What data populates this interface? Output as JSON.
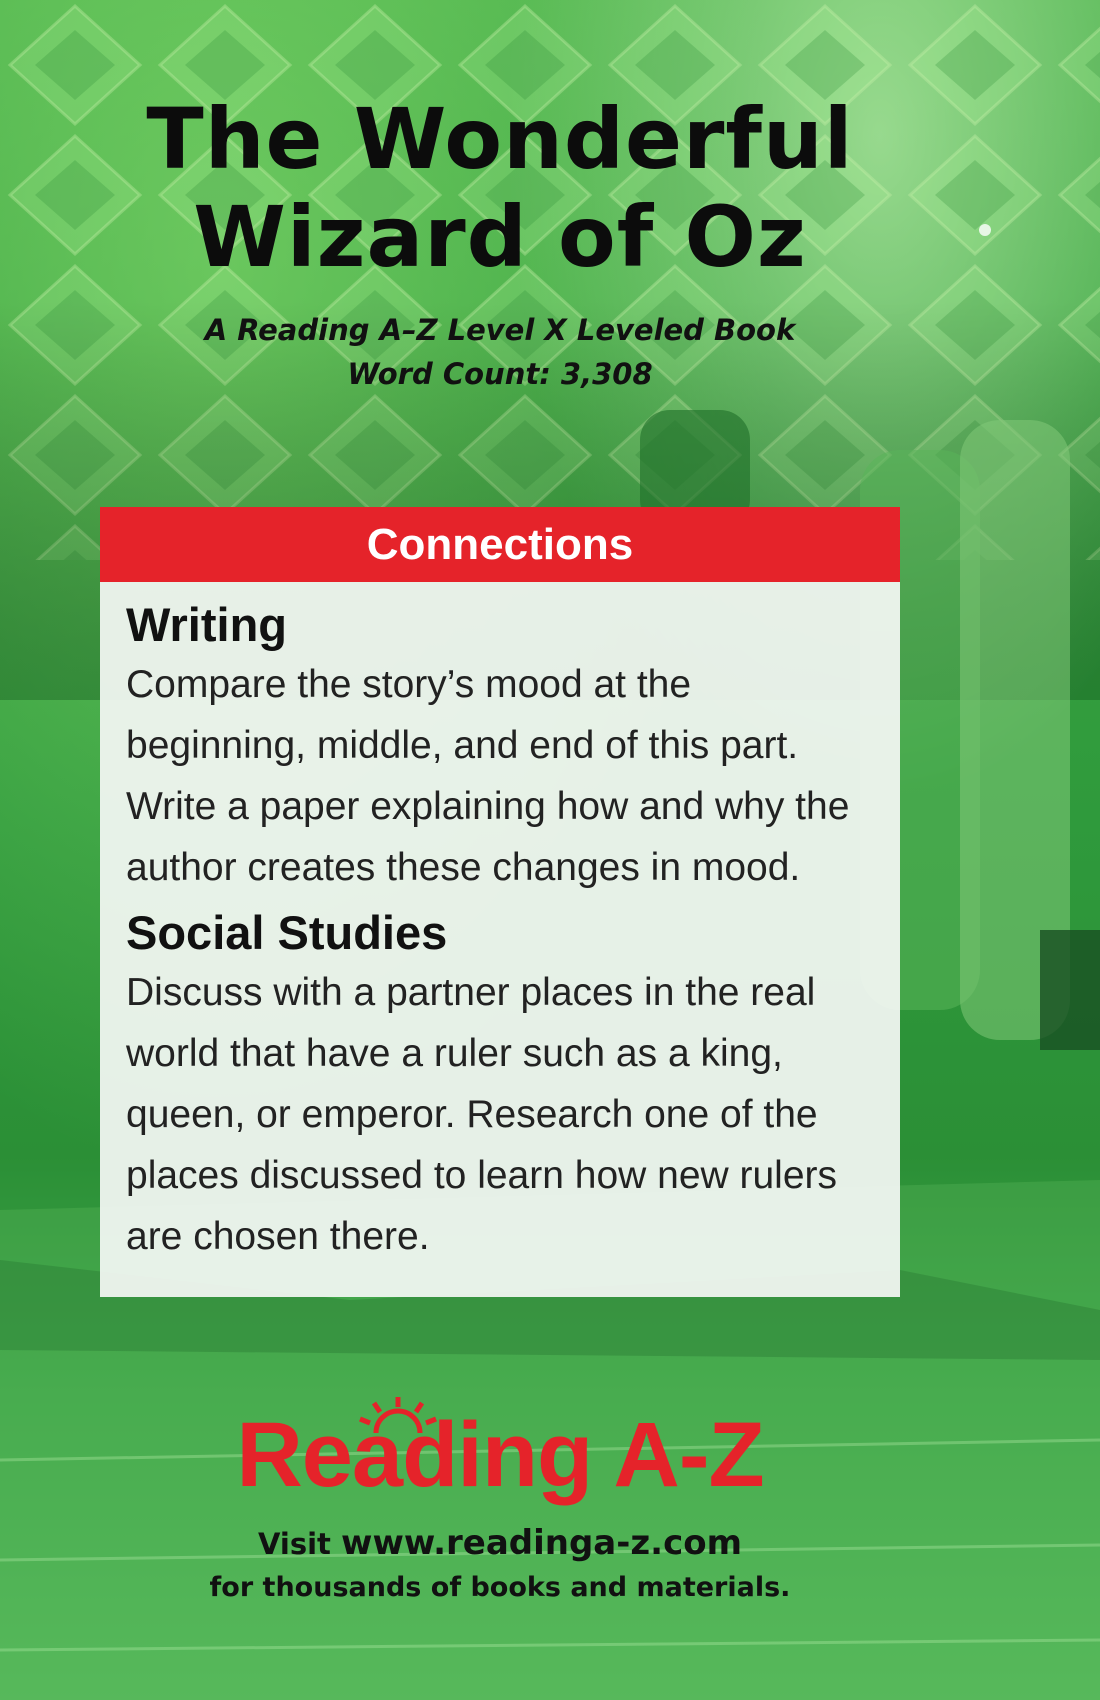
{
  "cover": {
    "title_line1": "The Wonderful",
    "title_line2": "Wizard of Oz",
    "subtitle_line1": "A Reading A–Z Level X Leveled Book",
    "subtitle_line2": "Word Count: 3,308"
  },
  "connections": {
    "header": "Connections",
    "sections": [
      {
        "heading": "Writing",
        "text": "Compare the story’s mood at the beginning, middle, and end of this part. Write a paper explaining how and why the author creates these changes in mood."
      },
      {
        "heading": "Social Studies",
        "text": "Discuss with a partner places in the real world that have a ruler such as a king, queen, or emperor. Research one of the places discussed to learn how new rulers are chosen there."
      }
    ]
  },
  "footer": {
    "logo": "Reading A-Z",
    "visit_label": "Visit",
    "url": "www.readinga-z.com",
    "tagline": "for thousands of books and materials."
  },
  "colors": {
    "accent_red": "#e5232a",
    "background_green": "#3aa441"
  }
}
